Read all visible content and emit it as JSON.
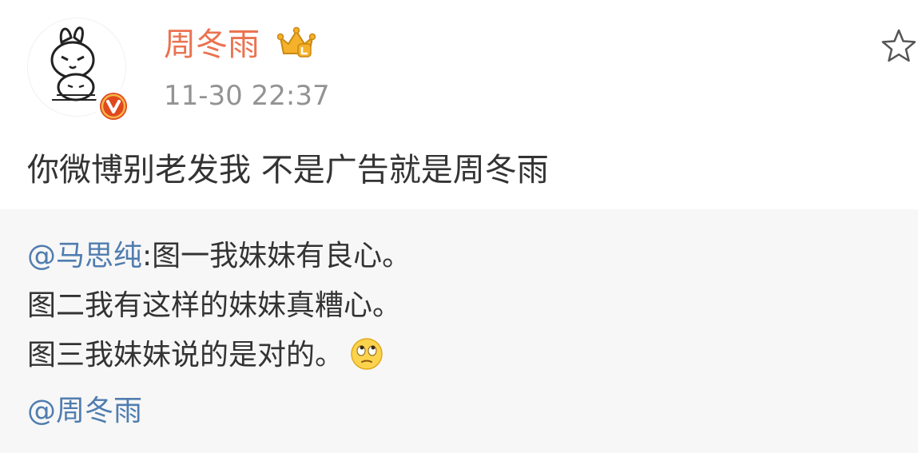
{
  "post": {
    "author": {
      "name": "周冬雨",
      "verified": true,
      "vip": true
    },
    "timestamp": "11-30 22:37",
    "text": "你微博别老发我 不是广告就是周冬雨"
  },
  "repost": {
    "mention_author": "@马思纯",
    "separator": ":",
    "lines": [
      "图一我妹妹有良心。",
      "图二我有这样的妹妹真糟心。",
      "图三我妹妹说的是对的。"
    ],
    "trailing_mention": "@周冬雨",
    "emoji": "eye-roll-emoji"
  },
  "colors": {
    "author_name": "#eb7350",
    "mention": "#507daf",
    "timestamp": "#939393",
    "body_text": "#333333",
    "repost_background": "#f7f7f7",
    "verified_badge": "#e0491e",
    "vip_crown": "#f5b12a"
  },
  "icons": {
    "favorite": "star-outline-icon",
    "verified": "verified-v-badge-icon",
    "vip": "vip-crown-icon"
  }
}
